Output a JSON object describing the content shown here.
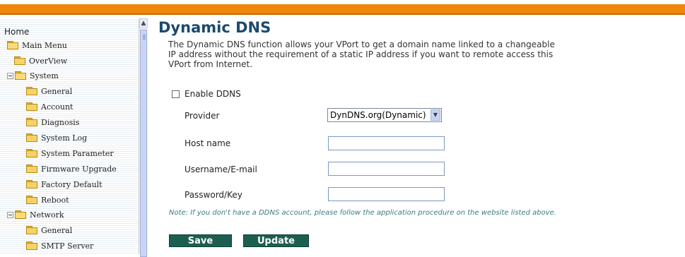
{
  "sidebar": {
    "home": "Home",
    "items": [
      {
        "label": "Main Menu"
      },
      {
        "label": "OverView"
      },
      {
        "label": "System"
      },
      {
        "label": "General"
      },
      {
        "label": "Account"
      },
      {
        "label": "Diagnosis"
      },
      {
        "label": "System Log"
      },
      {
        "label": "System Parameter"
      },
      {
        "label": "Firmware Upgrade"
      },
      {
        "label": "Factory Default"
      },
      {
        "label": "Reboot"
      },
      {
        "label": "Network"
      },
      {
        "label": "General"
      },
      {
        "label": "SMTP Server"
      }
    ]
  },
  "main": {
    "title": "Dynamic DNS",
    "description": "The Dynamic DNS function allows your VPort to get a domain name linked to a changeable IP address without the requirement of a static IP address if you want to remote access this VPort from Internet.",
    "enable_label": "Enable DDNS",
    "enable_checked": false,
    "provider_label": "Provider",
    "provider_value": "DynDNS.org(Dynamic)",
    "hostname_label": "Host name",
    "hostname_value": "",
    "username_label": "Username/E-mail",
    "username_value": "",
    "password_label": "Password/Key",
    "password_value": "",
    "note": "Note: If you don't have a DDNS account, please follow the application procedure on the website listed above.",
    "save_label": "Save",
    "update_label": "Update"
  },
  "colors": {
    "topbar": "#f0860c",
    "title": "#1c4a6e",
    "button": "#1c5f50",
    "note": "#3a7d80"
  }
}
